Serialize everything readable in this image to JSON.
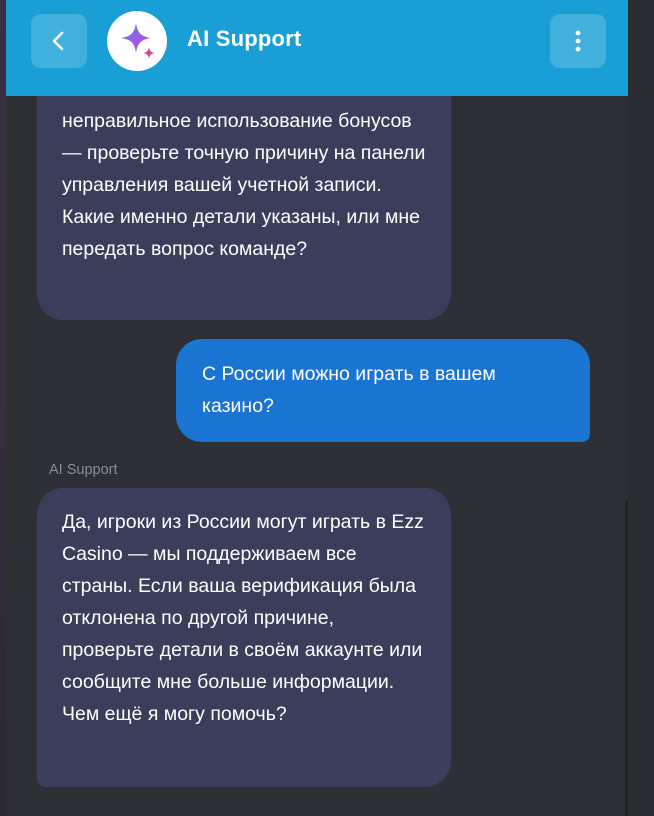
{
  "header": {
    "title": "AI Support",
    "back_icon": "chevron-left-icon",
    "menu_icon": "kebab-menu-icon",
    "avatar_icon": "sparkle-star-icon",
    "color": "#199fd6"
  },
  "messages": [
    {
      "role": "bot",
      "text": "неправильное использование бонусов — проверьте точную причину на панели управления вашей учетной записи. Какие именно детали указаны, или мне передать вопрос команде?"
    },
    {
      "role": "user",
      "text": "С России можно играть в вашем казино?"
    },
    {
      "role": "bot",
      "sender": "AI Support",
      "text": "Да, игроки из России могут играть в Ezz Casino — мы поддерживаем все страны. Если ваша верификация была отклонена по другой причине, проверьте детали в своём аккаунте или сообщите мне больше информации. Чем ещё я могу помочь?"
    }
  ],
  "colors": {
    "bot_bubble": "#3b3e5b",
    "user_bubble": "#1a74d2",
    "background": "#2e2f35"
  }
}
